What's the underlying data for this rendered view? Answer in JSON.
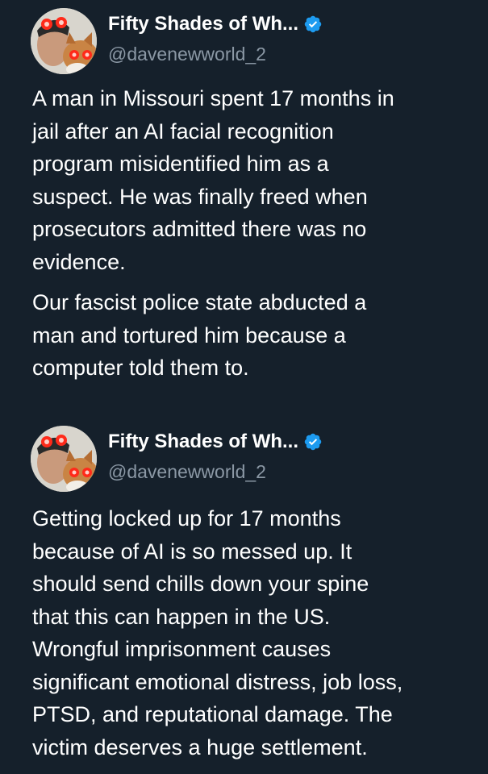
{
  "tweets": [
    {
      "author": {
        "display_name": "Fifty Shades of Wh...",
        "handle": "@davenewworld_2",
        "verified": true,
        "avatar_icon": "avatar-man-with-dog-red-eyes"
      },
      "paragraphs": [
        [
          "A man in Missouri spent 17 months in",
          "jail after an AI facial recognition",
          "program misidentified him as a",
          "suspect. He was finally freed when",
          "prosecutors admitted there was no",
          "evidence."
        ],
        [
          "Our fascist police state abducted a",
          "man and tortured him because a",
          "computer told them to."
        ]
      ]
    },
    {
      "author": {
        "display_name": "Fifty Shades of Wh...",
        "handle": "@davenewworld_2",
        "verified": true,
        "avatar_icon": "avatar-man-with-dog-red-eyes"
      },
      "paragraphs": [
        [
          "Getting locked up for 17 months",
          "because of AI is so messed up. It",
          "should send chills down your spine",
          "that this can happen in the US.",
          "Wrongful imprisonment causes",
          "significant emotional distress, job loss,",
          "PTSD, and reputational damage. The",
          "victim deserves a huge settlement."
        ]
      ]
    }
  ],
  "colors": {
    "background": "#15202b",
    "text": "#ffffff",
    "handle": "#8b98a5",
    "verified": "#1d9bf0"
  }
}
